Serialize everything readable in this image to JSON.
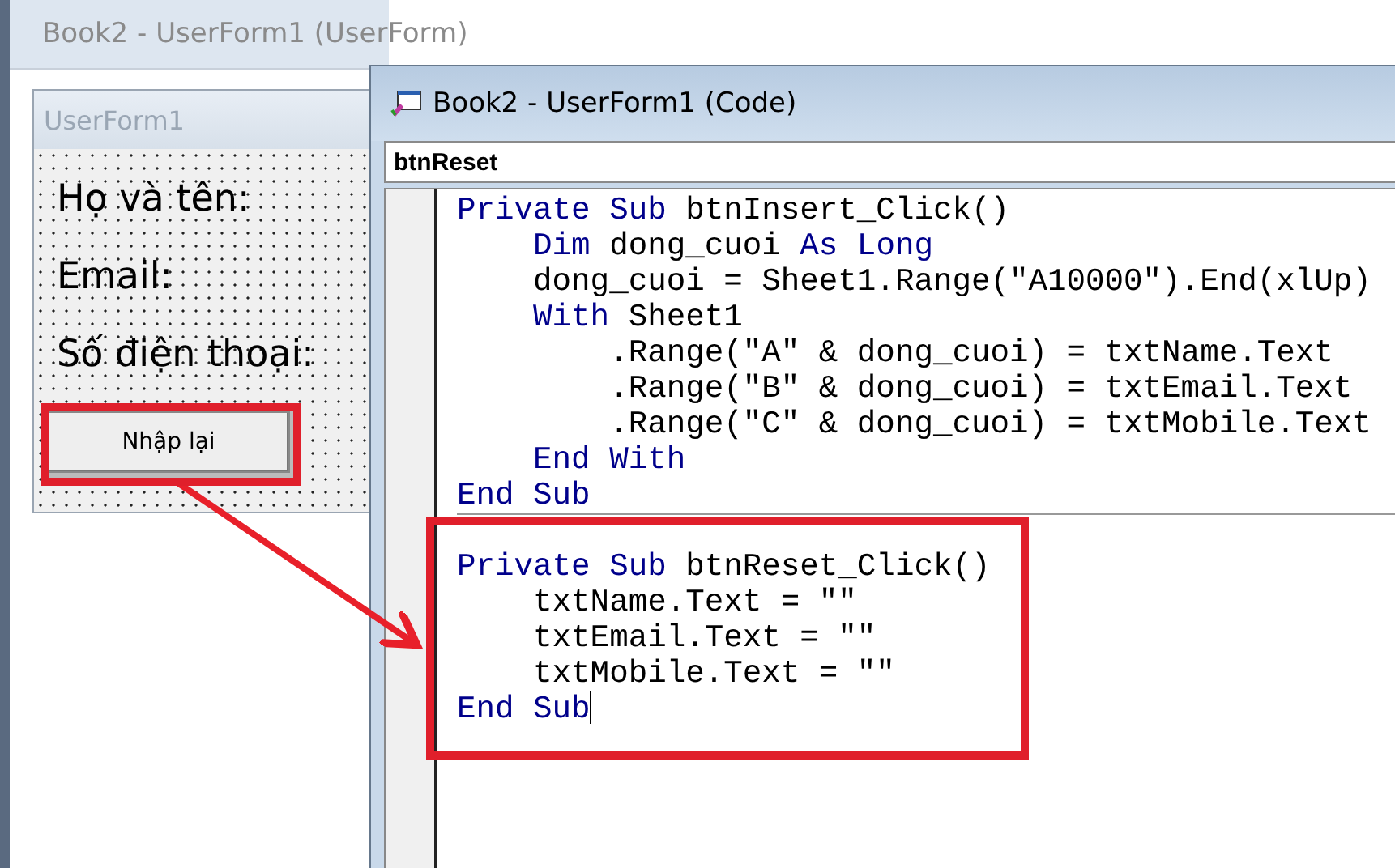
{
  "designer_window": {
    "title": "Book2 - UserForm1 (UserForm)"
  },
  "userform": {
    "title": "UserForm1",
    "labels": [
      "Họ và tên:",
      "Email:",
      "Số điện thoại:"
    ],
    "button": {
      "label": "Nhập lại",
      "selected": true
    }
  },
  "code_window": {
    "title": "Book2 - UserForm1 (Code)",
    "object_box": "btnReset",
    "procedures": [
      {
        "lines": [
          {
            "caret": false,
            "tokens": [
              {
                "kind": "keyword",
                "text": "Private Sub"
              },
              {
                "kind": "plain",
                "text": " btnInsert_Click()"
              }
            ]
          },
          {
            "caret": false,
            "tokens": [
              {
                "kind": "keyword",
                "text": "    Dim"
              },
              {
                "kind": "plain",
                "text": " dong_cuoi "
              },
              {
                "kind": "keyword",
                "text": "As Long"
              }
            ]
          },
          {
            "caret": false,
            "tokens": [
              {
                "kind": "plain",
                "text": "    dong_cuoi = Sheet1.Range(\"A10000\").End(xlUp)"
              }
            ]
          },
          {
            "caret": false,
            "tokens": [
              {
                "kind": "keyword",
                "text": "    With"
              },
              {
                "kind": "plain",
                "text": " Sheet1"
              }
            ]
          },
          {
            "caret": false,
            "tokens": [
              {
                "kind": "plain",
                "text": "        .Range(\"A\" & dong_cuoi) = txtName.Text"
              }
            ]
          },
          {
            "caret": false,
            "tokens": [
              {
                "kind": "plain",
                "text": "        .Range(\"B\" & dong_cuoi) = txtEmail.Text"
              }
            ]
          },
          {
            "caret": false,
            "tokens": [
              {
                "kind": "plain",
                "text": "        .Range(\"C\" & dong_cuoi) = txtMobile.Text"
              }
            ]
          },
          {
            "caret": false,
            "tokens": [
              {
                "kind": "keyword",
                "text": "    End With"
              }
            ]
          },
          {
            "caret": false,
            "tokens": [
              {
                "kind": "keyword",
                "text": "End Sub"
              }
            ]
          }
        ]
      },
      {
        "lines": [
          {
            "caret": false,
            "tokens": [
              {
                "kind": "keyword",
                "text": "Private Sub"
              },
              {
                "kind": "plain",
                "text": " btnReset_Click()"
              }
            ]
          },
          {
            "caret": false,
            "tokens": [
              {
                "kind": "plain",
                "text": "    txtName.Text = \"\""
              }
            ]
          },
          {
            "caret": false,
            "tokens": [
              {
                "kind": "plain",
                "text": "    txtEmail.Text = \"\""
              }
            ]
          },
          {
            "caret": false,
            "tokens": [
              {
                "kind": "plain",
                "text": "    txtMobile.Text = \"\""
              }
            ]
          },
          {
            "caret": true,
            "tokens": [
              {
                "kind": "keyword",
                "text": "End Sub"
              }
            ]
          }
        ]
      }
    ]
  }
}
